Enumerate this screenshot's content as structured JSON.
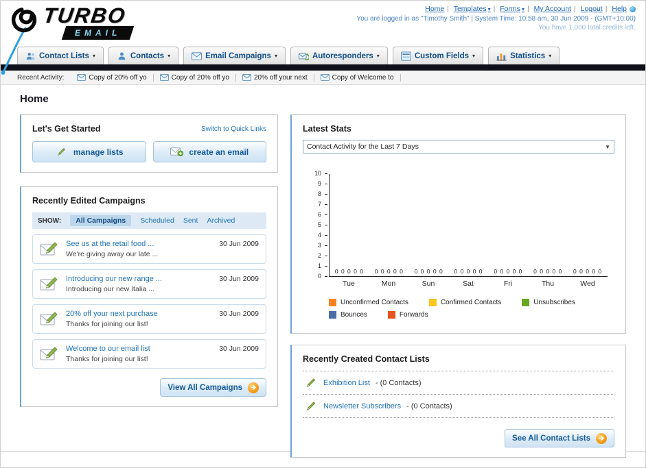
{
  "header": {
    "logo_line1": "TURBO",
    "logo_line2": "EMAIL",
    "links": [
      {
        "label": "Home"
      },
      {
        "label": "Templates"
      },
      {
        "label": "Forms"
      },
      {
        "label": "My Account"
      },
      {
        "label": "Logout"
      },
      {
        "label": "Help"
      }
    ],
    "login_info": "You are logged in as \"Timothy Smith\" | System Time: 10:58 am, 30 Jun 2009 - (GMT+10:00)",
    "credits": "You have 1,000 total credits left."
  },
  "nav": {
    "tabs": [
      {
        "label": "Contact Lists"
      },
      {
        "label": "Contacts"
      },
      {
        "label": "Email Campaigns"
      },
      {
        "label": "Autoresponders"
      },
      {
        "label": "Custom Fields"
      },
      {
        "label": "Statistics"
      }
    ]
  },
  "recent_activity": {
    "label": "Recent Activity:",
    "items": [
      "Copy of 20% off yo",
      "Copy of 20% off yo",
      "20% off your next",
      "Copy of Welcome to"
    ]
  },
  "page_title": "Home",
  "get_started": {
    "title": "Let's Get Started",
    "switch_label": "Switch to Quick Links",
    "buttons": [
      {
        "label": "manage lists"
      },
      {
        "label": "create an email"
      }
    ]
  },
  "campaigns": {
    "title": "Recently Edited Campaigns",
    "show_label": "SHOW:",
    "filters": [
      {
        "label": "All Campaigns",
        "selected": true
      },
      {
        "label": "Scheduled",
        "selected": false
      },
      {
        "label": "Sent",
        "selected": false
      },
      {
        "label": "Archived",
        "selected": false
      }
    ],
    "items": [
      {
        "title": "See us at the retail food ...",
        "subtitle": "We're giving away our late ...",
        "date": "30 Jun 2009"
      },
      {
        "title": "Introducing our new range ...",
        "subtitle": "Introducing our new Italia ...",
        "date": "30 Jun 2009"
      },
      {
        "title": "20% off your next purchase",
        "subtitle": "Thanks for joining our list!",
        "date": "30 Jun 2009"
      },
      {
        "title": "Welcome to our email list",
        "subtitle": "Thanks for joining our list!",
        "date": "30 Jun 2009"
      }
    ],
    "view_all_label": "View All Campaigns"
  },
  "stats": {
    "title": "Latest Stats",
    "dropdown_value": "Contact Activity for the Last 7 Days",
    "chart_data": {
      "type": "bar",
      "title": "Contact Activity for the Last 7 Days",
      "categories": [
        "Tue",
        "Mon",
        "Sun",
        "Sat",
        "Fri",
        "Thu",
        "Wed"
      ],
      "series": [
        {
          "name": "Unconfirmed Contacts",
          "color": "#f58220",
          "values": [
            0,
            0,
            0,
            0,
            0,
            0,
            0
          ]
        },
        {
          "name": "Confirmed Contacts",
          "color": "#fdc51c",
          "values": [
            0,
            0,
            0,
            0,
            0,
            0,
            0
          ]
        },
        {
          "name": "Unsubscribes",
          "color": "#64a820",
          "values": [
            0,
            0,
            0,
            0,
            0,
            0,
            0
          ]
        },
        {
          "name": "Bounces",
          "color": "#4a6fa8",
          "values": [
            0,
            0,
            0,
            0,
            0,
            0,
            0
          ]
        },
        {
          "name": "Forwards",
          "color": "#e8541e",
          "values": [
            0,
            0,
            0,
            0,
            0,
            0,
            0
          ]
        }
      ],
      "xlabel": "",
      "ylabel": "",
      "ylim": [
        0,
        10
      ],
      "yticks": [
        0,
        1,
        2,
        3,
        4,
        5,
        6,
        7,
        8,
        9,
        10
      ],
      "grid": false,
      "legend_position": "bottom"
    }
  },
  "contact_lists": {
    "title": "Recently Created Contact Lists",
    "items": [
      {
        "name": "Exhibition List",
        "suffix": "- (0 Contacts)"
      },
      {
        "name": "Newsletter Subscribers",
        "suffix": "- (0 Contacts)"
      }
    ],
    "see_all_label": "See All Contact Lists"
  }
}
